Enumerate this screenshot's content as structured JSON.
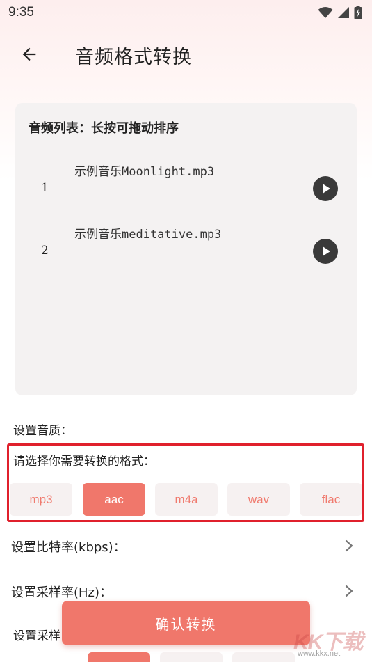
{
  "status_bar": {
    "time": "9:35"
  },
  "app_bar": {
    "title": "音频格式转换"
  },
  "audio_list": {
    "title": "音频列表：长按可拖动排序",
    "items": [
      {
        "index": "1",
        "name": "示例音乐Moonlight.mp3"
      },
      {
        "index": "2",
        "name": "示例音乐meditative.mp3"
      }
    ]
  },
  "quality": {
    "label": "设置音质："
  },
  "format": {
    "label": "请选择你需要转换的格式：",
    "options": [
      "mp3",
      "aac",
      "m4a",
      "wav",
      "flac"
    ],
    "selected": "aac"
  },
  "settings": {
    "bitrate_label": "设置比特率(kbps)：",
    "samplerate_label": "设置采样率(Hz)：",
    "partial_label": "设置采样"
  },
  "confirm": {
    "label": "确认转换"
  },
  "watermark": {
    "logo": "KK下载",
    "url": "www.kkx.net"
  },
  "colors": {
    "accent": "#f0776b",
    "highlight_border": "#e0202c",
    "card_bg": "#f4f2f2"
  }
}
